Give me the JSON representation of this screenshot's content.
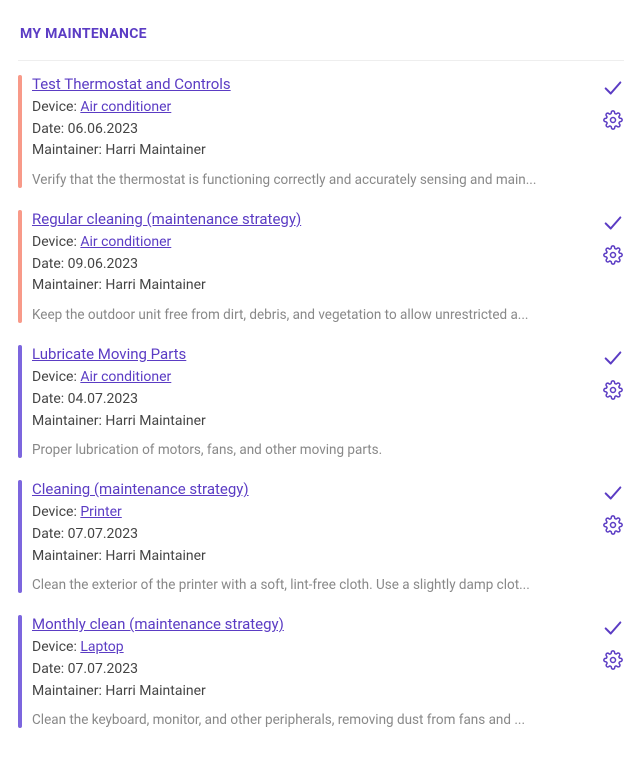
{
  "panel": {
    "title": "MY MAINTENANCE"
  },
  "labels": {
    "device_prefix": "Device: ",
    "date_prefix": "Date: ",
    "maintainer_prefix": "Maintainer: "
  },
  "tasks": [
    {
      "accent": "red",
      "title": "Test Thermostat and Controls",
      "device": "Air conditioner",
      "date": "06.06.2023",
      "maintainer": "Harri Maintainer",
      "note": "Verify that the thermostat is functioning correctly and accurately sensing and main..."
    },
    {
      "accent": "red",
      "title": "Regular cleaning (maintenance strategy)",
      "device": "Air conditioner",
      "date": "09.06.2023",
      "maintainer": "Harri Maintainer",
      "note": "Keep the outdoor unit free from dirt, debris, and vegetation to allow unrestricted a..."
    },
    {
      "accent": "purple",
      "title": "Lubricate Moving Parts",
      "device": "Air conditioner",
      "date": "04.07.2023",
      "maintainer": "Harri Maintainer",
      "note": "Proper lubrication of motors, fans, and other moving parts."
    },
    {
      "accent": "purple",
      "title": "Cleaning (maintenance strategy)",
      "device": "Printer",
      "date": "07.07.2023",
      "maintainer": "Harri Maintainer",
      "note": "Clean the exterior of the printer with a soft, lint-free cloth. Use a slightly damp clot..."
    },
    {
      "accent": "purple",
      "title": "Monthly clean (maintenance strategy)",
      "device": "Laptop",
      "date": "07.07.2023",
      "maintainer": "Harri Maintainer",
      "note": "Clean the keyboard, monitor, and other peripherals, removing dust from fans and ..."
    }
  ]
}
